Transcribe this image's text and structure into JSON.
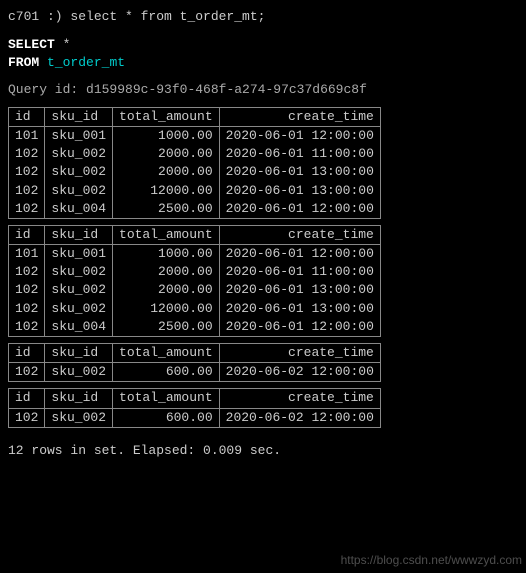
{
  "prompt_line": "c701 :) select * from t_order_mt;",
  "echo": {
    "select_kw": "SELECT",
    "star": "*",
    "from_kw": "FROM",
    "table": "t_order_mt"
  },
  "query_id_label": "Query id:",
  "query_id": "d159989c-93f0-468f-a274-97c37d669c8f",
  "columns": [
    "id",
    "sku_id",
    "total_amount",
    "create_time"
  ],
  "blocks": [
    {
      "rows": [
        {
          "id": "101",
          "sku_id": "sku_001",
          "total_amount": "1000.00",
          "create_time": "2020-06-01 12:00:00"
        },
        {
          "id": "102",
          "sku_id": "sku_002",
          "total_amount": "2000.00",
          "create_time": "2020-06-01 11:00:00"
        },
        {
          "id": "102",
          "sku_id": "sku_002",
          "total_amount": "2000.00",
          "create_time": "2020-06-01 13:00:00"
        },
        {
          "id": "102",
          "sku_id": "sku_002",
          "total_amount": "12000.00",
          "create_time": "2020-06-01 13:00:00"
        },
        {
          "id": "102",
          "sku_id": "sku_004",
          "total_amount": "2500.00",
          "create_time": "2020-06-01 12:00:00"
        }
      ]
    },
    {
      "rows": [
        {
          "id": "101",
          "sku_id": "sku_001",
          "total_amount": "1000.00",
          "create_time": "2020-06-01 12:00:00"
        },
        {
          "id": "102",
          "sku_id": "sku_002",
          "total_amount": "2000.00",
          "create_time": "2020-06-01 11:00:00"
        },
        {
          "id": "102",
          "sku_id": "sku_002",
          "total_amount": "2000.00",
          "create_time": "2020-06-01 13:00:00"
        },
        {
          "id": "102",
          "sku_id": "sku_002",
          "total_amount": "12000.00",
          "create_time": "2020-06-01 13:00:00"
        },
        {
          "id": "102",
          "sku_id": "sku_004",
          "total_amount": "2500.00",
          "create_time": "2020-06-01 12:00:00"
        }
      ]
    },
    {
      "rows": [
        {
          "id": "102",
          "sku_id": "sku_002",
          "total_amount": "600.00",
          "create_time": "2020-06-02 12:00:00"
        }
      ]
    },
    {
      "rows": [
        {
          "id": "102",
          "sku_id": "sku_002",
          "total_amount": "600.00",
          "create_time": "2020-06-02 12:00:00"
        }
      ]
    }
  ],
  "footer": "12 rows in set. Elapsed: 0.009 sec.",
  "watermark": "https://blog.csdn.net/wwwzyd.com"
}
